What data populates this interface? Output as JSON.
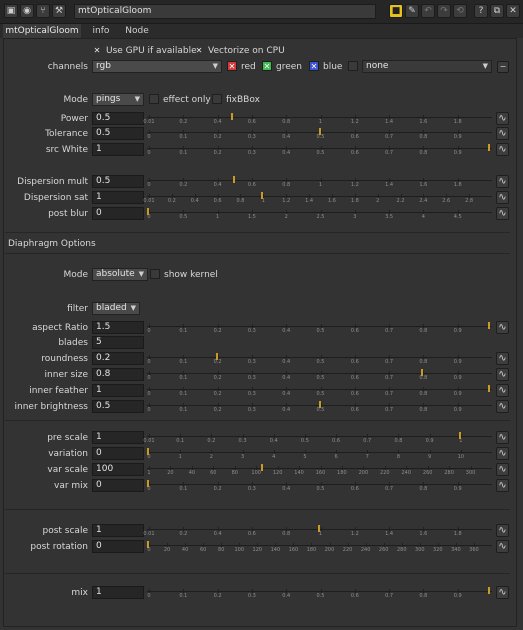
{
  "titlebar": {
    "node_name": "mtOpticalGloom",
    "icons": [
      "node-icon",
      "dot-icon",
      "fork-icon",
      "wrench-icon"
    ],
    "right_icons": [
      "yellow-square-icon",
      "pencil-icon",
      "undo-icon",
      "redo-icon",
      "revert-icon",
      "help-icon",
      "float-icon",
      "close-icon"
    ]
  },
  "tabs": [
    {
      "label": "mtOpticalGloom",
      "active": true
    },
    {
      "label": "info",
      "active": false
    },
    {
      "label": "Node",
      "active": false
    }
  ],
  "gpu": {
    "use_gpu_label": "Use GPU if available",
    "vectorize_label": "Vectorize on CPU"
  },
  "channels": {
    "label": "channels",
    "value": "rgb",
    "red_label": "red",
    "green_label": "green",
    "blue_label": "blue",
    "mask_value": "none"
  },
  "mode": {
    "label": "Mode",
    "value": "pings",
    "effect_only_label": "effect only",
    "fixbbox_label": "fixBBox"
  },
  "params": [
    {
      "label": "Power",
      "value": "0.5",
      "min": 0.01,
      "max": 2,
      "knob": 0.5,
      "ticks": [
        "0.01",
        "0.2",
        "0.4",
        "0.6",
        "0.8",
        "1",
        "1.2",
        "1.4",
        "1.6",
        "1.8"
      ]
    },
    {
      "label": "Tolerance",
      "value": "0.5",
      "min": 0,
      "max": 1,
      "knob": 0.5,
      "ticks": [
        "0",
        "0.1",
        "0.2",
        "0.3",
        "0.4",
        "0.5",
        "0.6",
        "0.7",
        "0.8",
        "0.9"
      ]
    },
    {
      "label": "src White",
      "value": "1",
      "min": 0,
      "max": 1,
      "knob": 1,
      "ticks": [
        "0",
        "0.1",
        "0.2",
        "0.3",
        "0.4",
        "0.5",
        "0.6",
        "0.7",
        "0.8",
        "0.9"
      ]
    },
    {
      "label": "Dispersion mult",
      "value": "0.5",
      "min": 0,
      "max": 2,
      "knob": 0.5,
      "ticks": [
        "0",
        "0.2",
        "0.4",
        "0.6",
        "0.8",
        "1",
        "1.2",
        "1.4",
        "1.6",
        "1.8"
      ]
    },
    {
      "label": "Dispersion sat",
      "value": "1",
      "min": 0.01,
      "max": 3,
      "knob": 1,
      "ticks": [
        "0.01",
        "0.2",
        "0.4",
        "0.6",
        "0.8",
        "1",
        "1.2",
        "1.4",
        "1.6",
        "1.8",
        "2",
        "2.2",
        "2.4",
        "2.6",
        "2.8"
      ]
    },
    {
      "label": "post blur",
      "value": "0",
      "min": 0,
      "max": 5,
      "knob": 0,
      "ticks": [
        "0",
        "0.5",
        "1",
        "1.5",
        "2",
        "2.5",
        "3",
        "3.5",
        "4",
        "4.5"
      ]
    }
  ],
  "diaphragm": {
    "section_label": "Diaphragm Options",
    "mode_label": "Mode",
    "mode_value": "absolute",
    "show_kernel_label": "show kernel",
    "filter_label": "filter",
    "filter_value": "bladed",
    "params": [
      {
        "label": "aspect Ratio",
        "value": "1.5",
        "min": 0,
        "max": 1,
        "knob": 1,
        "ticks": [
          "0",
          "0.1",
          "0.2",
          "0.3",
          "0.4",
          "0.5",
          "0.6",
          "0.7",
          "0.8",
          "0.9"
        ]
      },
      {
        "label": "blades",
        "value": "5"
      },
      {
        "label": "roundness",
        "value": "0.2",
        "min": 0,
        "max": 1,
        "knob": 0.2,
        "ticks": [
          "0",
          "0.1",
          "0.2",
          "0.3",
          "0.4",
          "0.5",
          "0.6",
          "0.7",
          "0.8",
          "0.9"
        ]
      },
      {
        "label": "inner size",
        "value": "0.8",
        "min": 0,
        "max": 1,
        "knob": 0.8,
        "ticks": [
          "0",
          "0.1",
          "0.2",
          "0.3",
          "0.4",
          "0.5",
          "0.6",
          "0.7",
          "0.8",
          "0.9"
        ]
      },
      {
        "label": "inner feather",
        "value": "1",
        "min": 0,
        "max": 1,
        "knob": 1,
        "ticks": [
          "0",
          "0.1",
          "0.2",
          "0.3",
          "0.4",
          "0.5",
          "0.6",
          "0.7",
          "0.8",
          "0.9"
        ]
      },
      {
        "label": "inner brightness",
        "value": "0.5",
        "min": 0,
        "max": 1,
        "knob": 0.5,
        "ticks": [
          "0",
          "0.1",
          "0.2",
          "0.3",
          "0.4",
          "0.5",
          "0.6",
          "0.7",
          "0.8",
          "0.9"
        ]
      }
    ]
  },
  "scale": [
    {
      "label": "pre scale",
      "value": "1",
      "min": 0.01,
      "max": 1.1,
      "knob": 1,
      "ticks": [
        "0.01",
        "0.1",
        "0.2",
        "0.3",
        "0.4",
        "0.5",
        "0.6",
        "0.7",
        "0.8",
        "0.9",
        "1"
      ]
    },
    {
      "label": "variation",
      "value": "0",
      "min": 0,
      "max": 10,
      "knob": 0,
      "ticks": [
        "0",
        "1",
        "2",
        "3",
        "4",
        "5",
        "6",
        "7",
        "8",
        "9",
        "10"
      ]
    },
    {
      "label": "var scale",
      "value": "100",
      "min": 1,
      "max": 300,
      "knob": 100,
      "ticks": [
        "1",
        "20",
        "40",
        "60",
        "80",
        "100",
        "120",
        "140",
        "160",
        "180",
        "200",
        "220",
        "240",
        "260",
        "280",
        "300"
      ]
    },
    {
      "label": "var mix",
      "value": "0",
      "min": 0,
      "max": 1,
      "knob": 0,
      "ticks": [
        "0",
        "0.1",
        "0.2",
        "0.3",
        "0.4",
        "0.5",
        "0.6",
        "0.7",
        "0.8",
        "0.9"
      ]
    }
  ],
  "post": [
    {
      "label": "post scale",
      "value": "1",
      "min": 0.01,
      "max": 2,
      "knob": 1,
      "ticks": [
        "0.01",
        "0.2",
        "0.4",
        "0.6",
        "0.8",
        "1",
        "1.2",
        "1.4",
        "1.6",
        "1.8"
      ]
    },
    {
      "label": "post rotation",
      "value": "0",
      "min": 0,
      "max": 360,
      "knob": 0,
      "ticks": [
        "0",
        "20",
        "40",
        "60",
        "80",
        "100",
        "120",
        "140",
        "160",
        "180",
        "200",
        "220",
        "240",
        "260",
        "280",
        "300",
        "320",
        "340",
        "360"
      ]
    }
  ],
  "mix": {
    "label": "mix",
    "value": "1",
    "min": 0,
    "max": 1,
    "knob": 1,
    "ticks": [
      "0",
      "0.1",
      "0.2",
      "0.3",
      "0.4",
      "0.5",
      "0.6",
      "0.7",
      "0.8",
      "0.9"
    ]
  },
  "colors": {
    "knob": "#c89a2a",
    "red": "#d23b3b",
    "green": "#3fb94f",
    "blue": "#3b55d2"
  }
}
